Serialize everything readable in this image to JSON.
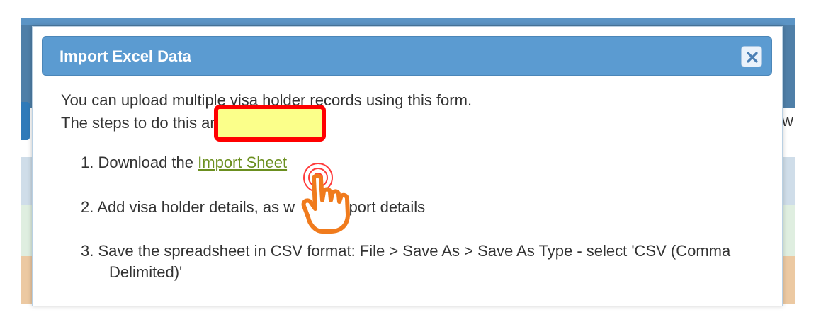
{
  "modal": {
    "title": "Import Excel Data",
    "intro_line1": "You can upload multiple visa holder records using this form.",
    "intro_line2": "The steps to do this are:",
    "steps": [
      {
        "num": "1.",
        "text_before": "Download the ",
        "link": "Import Sheet"
      },
      {
        "num": "2.",
        "text_a": "Add visa holder details, as w",
        "text_b": "passport details"
      },
      {
        "num": "3.",
        "line1": "Save the spreadsheet in CSV format: File > Save As > Save As Type - select 'CSV (Comma",
        "line2": "Delimited)'"
      }
    ]
  },
  "background": {
    "edge_text": "w"
  },
  "icons": {
    "close": "close-icon",
    "pointer": "hand-pointer-icon"
  },
  "colors": {
    "header_blue": "#5b9bd1",
    "highlight_border": "#ff0000",
    "highlight_fill": "#fbff8a",
    "link": "#6b8f1f",
    "hand": "#f07b1d"
  }
}
